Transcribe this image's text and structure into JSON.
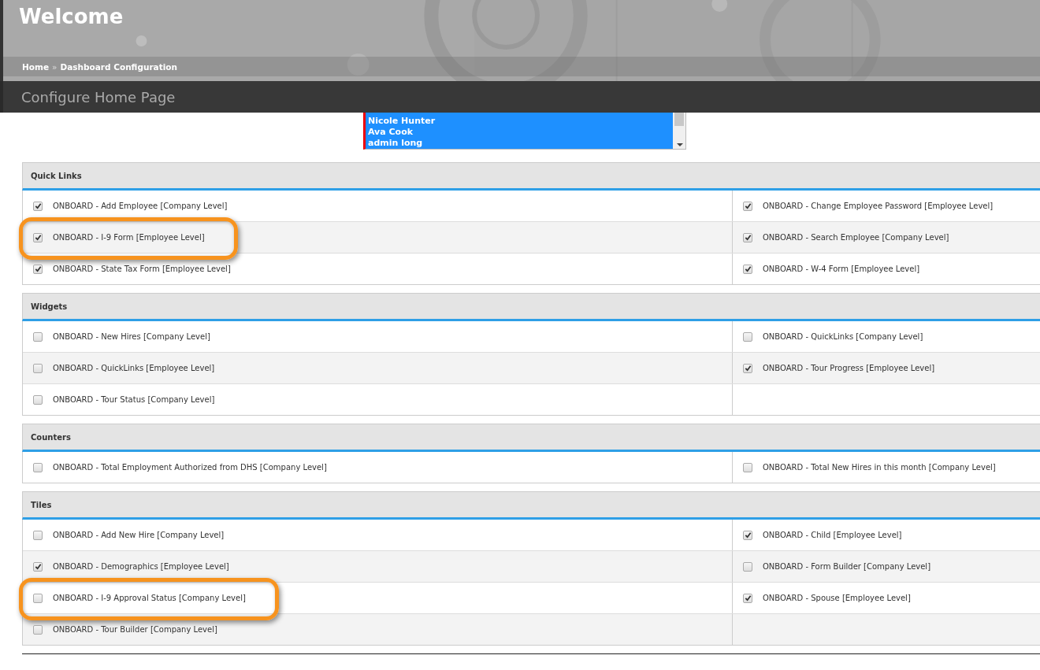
{
  "header": {
    "title": "Welcome",
    "breadcrumb": [
      {
        "label": "Home"
      },
      {
        "label": "Dashboard Configuration"
      }
    ],
    "breadcrumb_separator": "»"
  },
  "page_title": "Configure Home Page",
  "user_list": {
    "items": [
      {
        "label": "Nicole Hunter",
        "selected": true
      },
      {
        "label": "Ava Cook",
        "selected": true
      },
      {
        "label": "admin long",
        "selected": true
      }
    ]
  },
  "sections": [
    {
      "title": "Quick Links",
      "rows": [
        [
          {
            "label": "ONBOARD - Add Employee [Company Level]",
            "checked": true,
            "highlighted": false
          },
          {
            "label": "ONBOARD - Change Employee Password [Employee Level]",
            "checked": true,
            "highlighted": false
          }
        ],
        [
          {
            "label": "ONBOARD - I-9 Form [Employee Level]",
            "checked": true,
            "highlighted": true
          },
          {
            "label": "ONBOARD - Search Employee [Company Level]",
            "checked": true,
            "highlighted": false
          }
        ],
        [
          {
            "label": "ONBOARD - State Tax Form [Employee Level]",
            "checked": true,
            "highlighted": false
          },
          {
            "label": "ONBOARD - W-4 Form [Employee Level]",
            "checked": true,
            "highlighted": false
          }
        ]
      ]
    },
    {
      "title": "Widgets",
      "rows": [
        [
          {
            "label": "ONBOARD - New Hires [Company Level]",
            "checked": false,
            "highlighted": false
          },
          {
            "label": "ONBOARD - QuickLinks [Company Level]",
            "checked": false,
            "highlighted": false
          }
        ],
        [
          {
            "label": "ONBOARD - QuickLinks [Employee Level]",
            "checked": false,
            "highlighted": false
          },
          {
            "label": "ONBOARD - Tour Progress [Employee Level]",
            "checked": true,
            "highlighted": false
          }
        ],
        [
          {
            "label": "ONBOARD - Tour Status [Company Level]",
            "checked": false,
            "highlighted": false
          }
        ]
      ]
    },
    {
      "title": "Counters",
      "rows": [
        [
          {
            "label": "ONBOARD - Total Employment Authorized from DHS [Company Level]",
            "checked": false,
            "highlighted": false
          },
          {
            "label": "ONBOARD - Total New Hires in this month [Company Level]",
            "checked": false,
            "highlighted": false
          }
        ]
      ]
    },
    {
      "title": "Tiles",
      "rows": [
        [
          {
            "label": "ONBOARD - Add New Hire [Company Level]",
            "checked": false,
            "highlighted": false
          },
          {
            "label": "ONBOARD - Child [Employee Level]",
            "checked": true,
            "highlighted": false
          }
        ],
        [
          {
            "label": "ONBOARD - Demographics [Employee Level]",
            "checked": true,
            "highlighted": false
          },
          {
            "label": "ONBOARD - Form Builder [Company Level]",
            "checked": false,
            "highlighted": false
          }
        ],
        [
          {
            "label": "ONBOARD - I-9 Approval Status [Company Level]",
            "checked": false,
            "highlighted": true
          },
          {
            "label": "ONBOARD - Spouse [Employee Level]",
            "checked": true,
            "highlighted": false
          }
        ],
        [
          {
            "label": "ONBOARD - Tour Builder [Company Level]",
            "checked": false,
            "highlighted": false
          }
        ]
      ]
    }
  ]
}
